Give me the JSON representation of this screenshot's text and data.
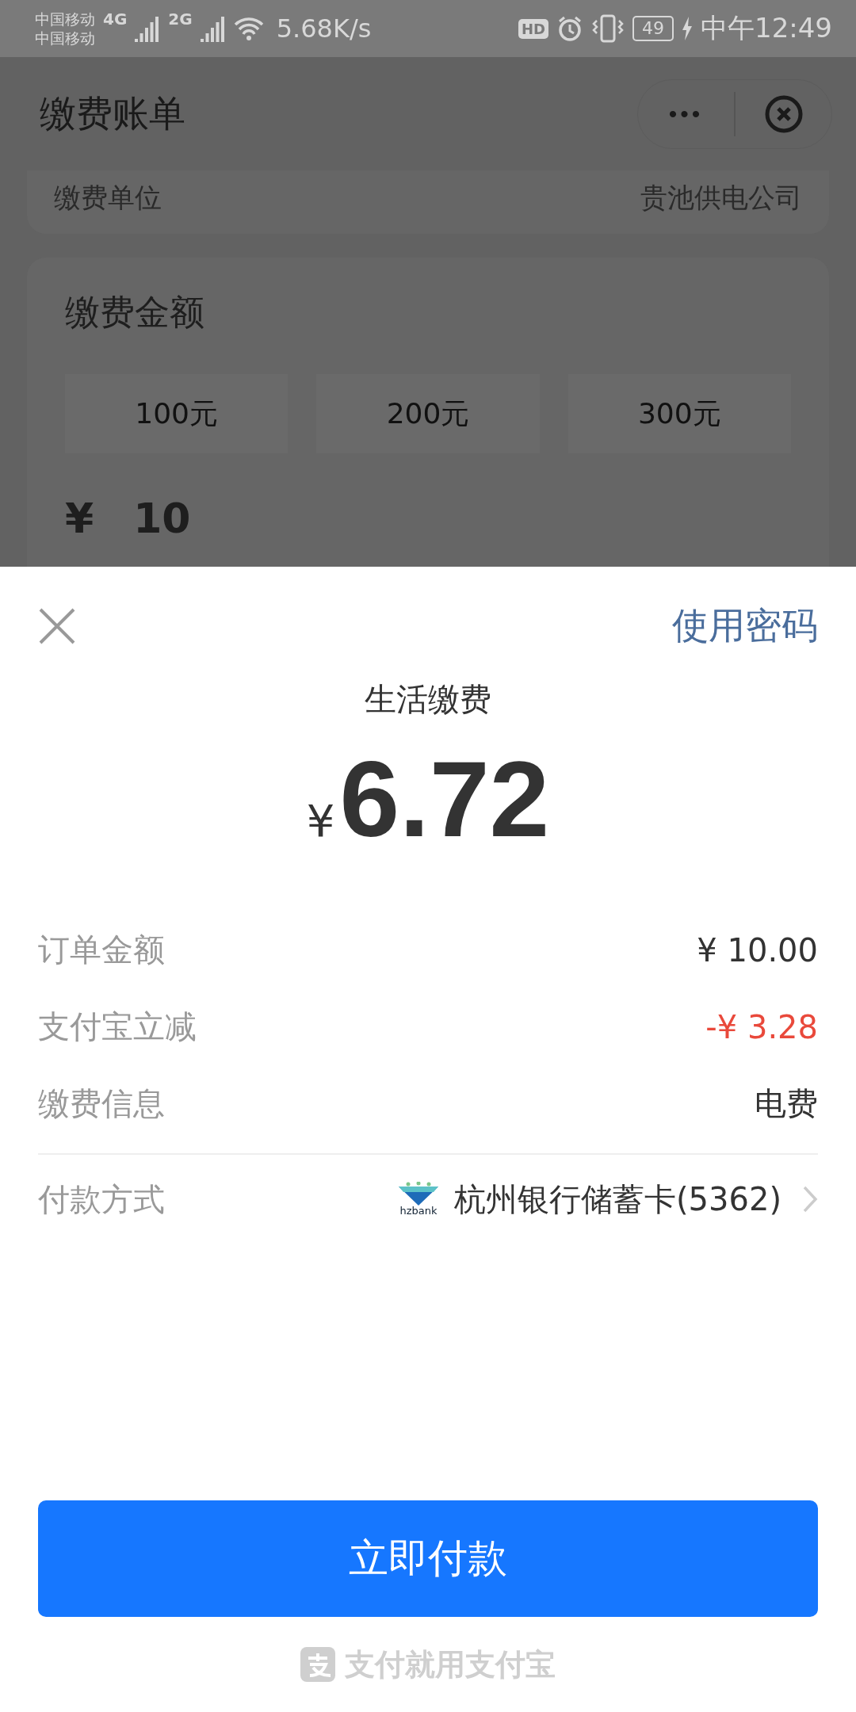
{
  "status_bar": {
    "carriers": [
      "中国移动",
      "中国移动"
    ],
    "network_types": [
      "4G",
      "2G"
    ],
    "speed": "5.68K/s",
    "hd": "HD",
    "battery": "49",
    "time": "中午12:49"
  },
  "nav_bar": {
    "title": "缴费账单",
    "more": "•••"
  },
  "background_page": {
    "unit_row": {
      "label": "缴费单位",
      "value": "贵池供电公司"
    },
    "amount_section": {
      "title": "缴费金额",
      "options": [
        {
          "label": "100元"
        },
        {
          "label": "200元"
        },
        {
          "label": "300元"
        }
      ],
      "currency": "¥",
      "value": "10"
    }
  },
  "payment_sheet": {
    "password_link": "使用密码",
    "title": "生活缴费",
    "currency": "¥",
    "amount": "6.72",
    "details": [
      {
        "label": "订单金额",
        "value": "¥ 10.00",
        "kind": "normal"
      },
      {
        "label": "支付宝立减",
        "value": "-¥ 3.28",
        "kind": "discount"
      },
      {
        "label": "缴费信息",
        "value": "电费",
        "kind": "normal"
      }
    ],
    "method": {
      "label": "付款方式",
      "bank_logo_text": "hzbank",
      "account": "杭州银行储蓄卡(5362)"
    },
    "pay_button": "立即付款",
    "footer_slogan": "支付就用支付宝"
  }
}
